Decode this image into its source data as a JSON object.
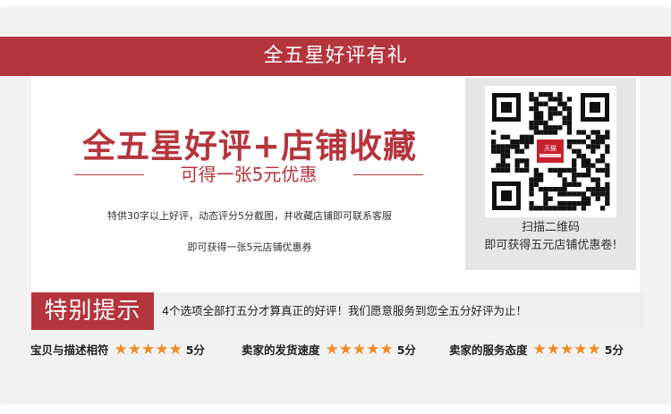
{
  "banner": {
    "title": "全五星好评有礼"
  },
  "main": {
    "headline": "全五星好评+店铺收藏",
    "subline": "可得一张5元优惠",
    "desc_line1": "特供30字以上好评，动态评分5分截图，并收藏店铺即可联系客服",
    "desc_line2": "即可获得一张5元店铺优惠券"
  },
  "qr": {
    "badge_text": "天猫",
    "caption_line1": "扫描二维码",
    "caption_line2": "即可获得五元店铺优惠卷!"
  },
  "notice": {
    "tag": "特别提示",
    "text": "4个选项全部打五分才算真正的好评！我们愿意服务到您全五分好评为止！"
  },
  "ratings": [
    {
      "label": "宝贝与描述相符",
      "stars": "★★★★★",
      "score": "5分"
    },
    {
      "label": "卖家的发货速度",
      "stars": "★★★★★",
      "score": "5分"
    },
    {
      "label": "卖家的服务态度",
      "stars": "★★★★★",
      "score": "5分"
    }
  ],
  "colors": {
    "brand_red": "#b5353d",
    "star_orange": "#f08a24"
  }
}
